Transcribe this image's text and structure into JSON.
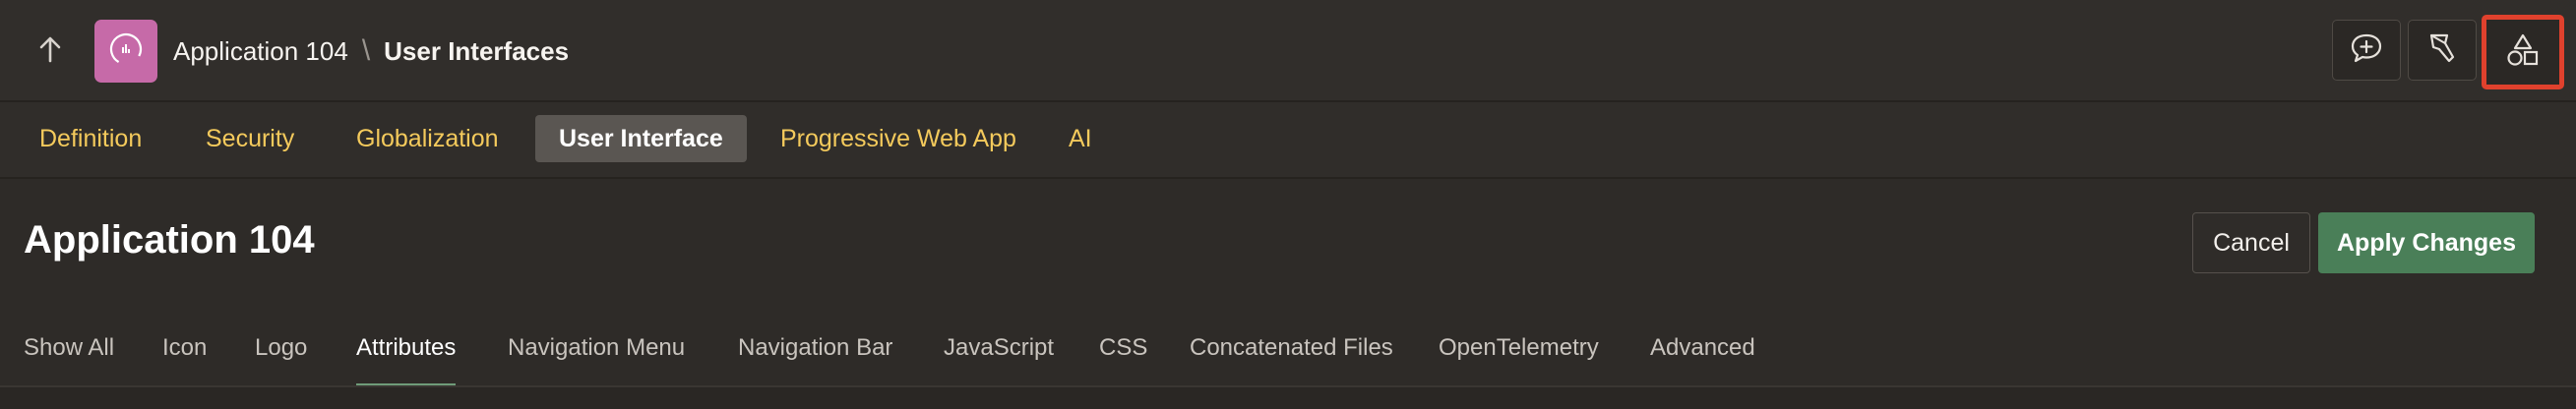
{
  "breadcrumb": {
    "app": "Application 104",
    "separator": "\\",
    "current": "User Interfaces"
  },
  "icons": {
    "up": "arrow-up-icon",
    "app": "app-gauge-icon",
    "comment": "add-comment-icon",
    "flashlight": "flashlight-icon",
    "shapes": "shared-components-shapes-icon"
  },
  "app_tabs": [
    {
      "label": "Definition"
    },
    {
      "label": "Security"
    },
    {
      "label": "Globalization"
    },
    {
      "label": "User Interface"
    },
    {
      "label": "Progressive Web App"
    },
    {
      "label": "AI"
    }
  ],
  "page": {
    "title": "Application 104",
    "cancel_label": "Cancel",
    "apply_label": "Apply Changes"
  },
  "sub_tabs": [
    {
      "label": "Show All"
    },
    {
      "label": "Icon"
    },
    {
      "label": "Logo"
    },
    {
      "label": "Attributes"
    },
    {
      "label": "Navigation Menu"
    },
    {
      "label": "Navigation Bar"
    },
    {
      "label": "JavaScript"
    },
    {
      "label": "CSS"
    },
    {
      "label": "Concatenated Files"
    },
    {
      "label": "OpenTelemetry"
    },
    {
      "label": "Advanced"
    }
  ],
  "colors": {
    "tab_text": "#f4ca5c",
    "apply_button": "#4a7f58",
    "app_icon": "#c66aa8",
    "highlight": "#e0412d"
  }
}
